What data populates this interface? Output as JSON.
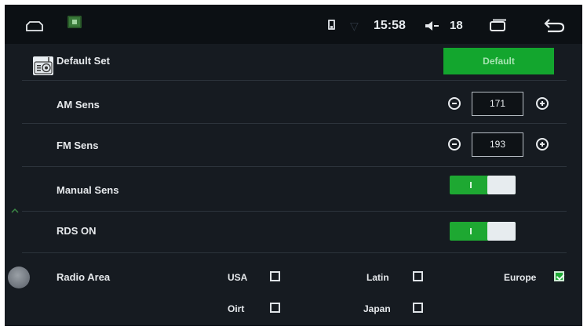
{
  "status_bar": {
    "time": "15:58",
    "volume": "18",
    "icons": [
      "home-icon",
      "app-icon",
      "sim-icon",
      "wifi-icon",
      "speaker-icon",
      "recent-apps-icon",
      "back-icon"
    ]
  },
  "default_set": {
    "label": "Default Set",
    "button_label": "Default",
    "icon": "radio-icon"
  },
  "am_sens": {
    "label": "AM Sens",
    "value": "171"
  },
  "fm_sens": {
    "label": "FM Sens",
    "value": "193"
  },
  "manual_sens": {
    "label": "Manual Sens",
    "state": "on"
  },
  "rds_on": {
    "label": "RDS ON",
    "state": "on"
  },
  "radio_area": {
    "label": "Radio Area",
    "options": [
      {
        "label": "USA",
        "checked": false
      },
      {
        "label": "Latin",
        "checked": false
      },
      {
        "label": "Europe",
        "checked": true
      },
      {
        "label": "Oirt",
        "checked": false
      },
      {
        "label": "Japan",
        "checked": false
      }
    ]
  },
  "colors": {
    "background": "#161b21",
    "status_bar": "#0c1014",
    "accent_green": "#13a62e",
    "text": "#e6e9ec"
  }
}
